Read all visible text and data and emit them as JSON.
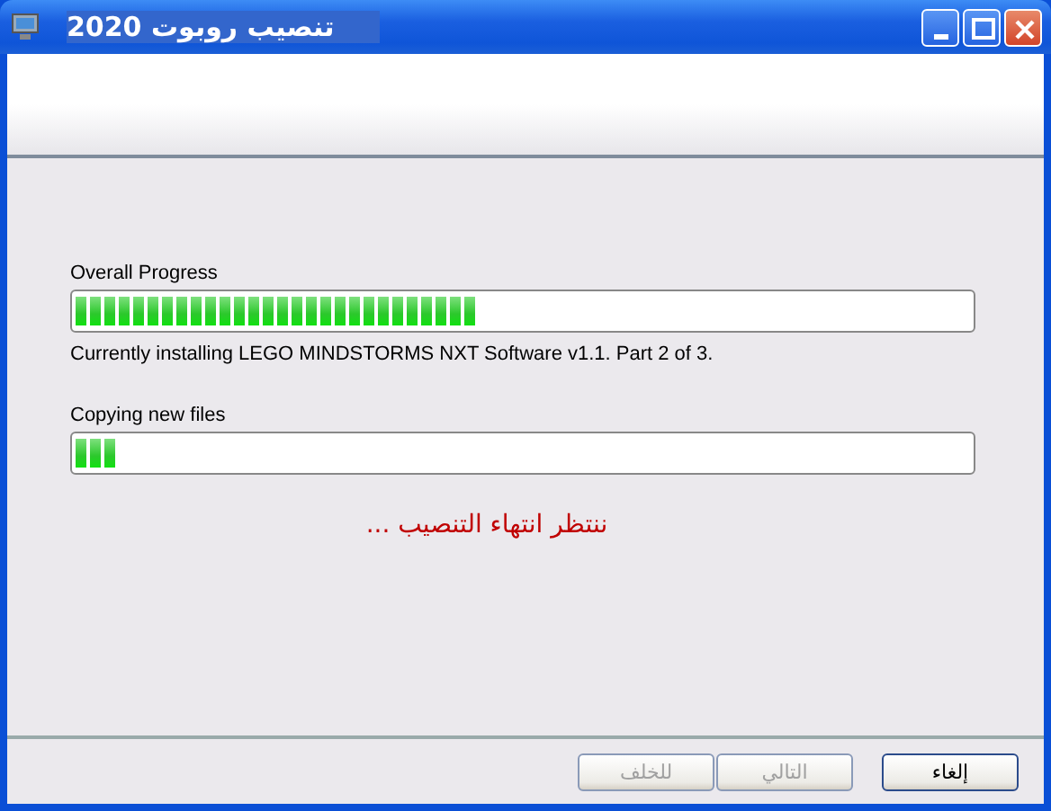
{
  "window": {
    "title": "تنصيب روبوت 2020"
  },
  "progress_bars": [
    {
      "label": "Overall Progress",
      "level": 0.45,
      "caption": "Currently installing LEGO MINDSTORMS NXT Software v1.1.  Part 2 of 3."
    },
    {
      "label": "Copying new files",
      "level": 0.045
    }
  ],
  "status_message": "ننتظر انتهاء التنصيب ...",
  "buttons": [
    {
      "label": "إلغاء",
      "disabled": false
    },
    {
      "label": "التالي",
      "disabled": true
    },
    {
      "label": "للخلف",
      "disabled": true
    }
  ]
}
